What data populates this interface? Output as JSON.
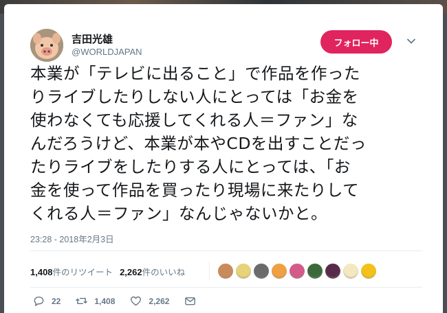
{
  "user": {
    "name": "吉田光雄",
    "handle": "@WORLDJAPAN"
  },
  "follow_button": {
    "label": "フォロー中",
    "color": "#e0245e"
  },
  "tweet": {
    "lines": [
      "本業が「テレビに出ること」で作品を作った",
      "りライブしたりしない人にとっては「お金を",
      "使わなくても応援してくれる人＝ファン」な",
      "んだろうけど、本業が本やCDを出すことだっ",
      "たりライブをしたりする人にとっては、「お",
      "金を使って作品を買ったり現場に来たりして",
      "くれる人＝ファン」なんじゃないかと。"
    ]
  },
  "timestamp": "23:28 - 2018年2月3日",
  "stats": {
    "retweets_count": "1,408",
    "retweets_label": "件のリツイート",
    "likes_count": "2,262",
    "likes_label": "件のいいね"
  },
  "likers": [
    {
      "icon": "liker-avatar",
      "color": "#c98b5a"
    },
    {
      "icon": "liker-avatar",
      "color": "#e8d27a"
    },
    {
      "icon": "liker-avatar",
      "color": "#6b6b6b"
    },
    {
      "icon": "liker-avatar",
      "color": "#f0a040"
    },
    {
      "icon": "liker-avatar",
      "color": "#d45a8a"
    },
    {
      "icon": "liker-avatar",
      "color": "#3a6a3a"
    },
    {
      "icon": "liker-avatar",
      "color": "#5a2a4a"
    },
    {
      "icon": "liker-avatar",
      "color": "#f3e8c0"
    },
    {
      "icon": "liker-avatar",
      "color": "#f2c21a"
    }
  ],
  "actions": {
    "reply_count": "22",
    "retweet_count": "1,408",
    "like_count": "2,262"
  }
}
